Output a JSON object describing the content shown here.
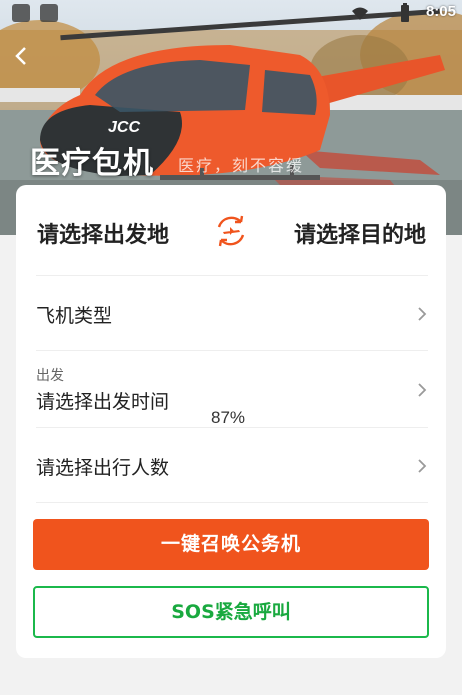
{
  "status_bar": {
    "time": "8:05",
    "icons": [
      "image-icon",
      "app-icon",
      "wifi-icon",
      "battery-icon"
    ]
  },
  "hero": {
    "title": "医疗包机",
    "subtitle": "医疗，刻不容缓",
    "back_icon": "chevron-left-icon",
    "helicopter_marking": "JCC"
  },
  "route": {
    "from_placeholder": "请选择出发地",
    "to_placeholder": "请选择目的地",
    "swap_icon": "plane-swap-icon"
  },
  "rows": {
    "aircraft_type": "飞机类型",
    "departure_label": "出发",
    "departure_placeholder": "请选择出发时间",
    "passengers_placeholder": "请选择出行人数"
  },
  "progress_text": "87%",
  "buttons": {
    "summon": "一键召唤公务机",
    "sos": "SOS紧急呼叫"
  },
  "colors": {
    "accent_orange": "#f0541d",
    "sos_green": "#1bb84b"
  }
}
